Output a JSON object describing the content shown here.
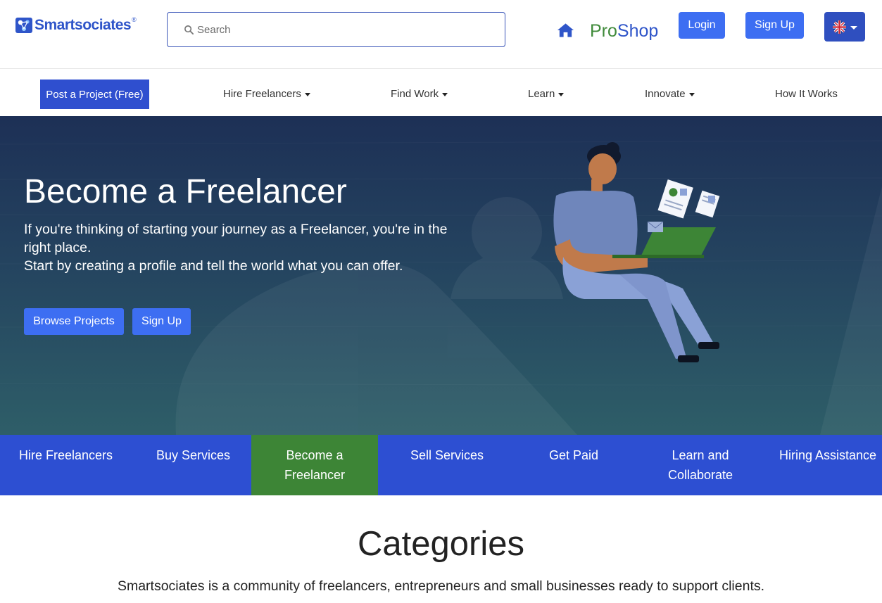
{
  "header": {
    "logo_text": "Smartsociates",
    "logo_reg": "®",
    "search_placeholder": "Search",
    "proshop_pro": "Pro",
    "proshop_shop": "Shop",
    "login_label": "Login",
    "signup_label": "Sign Up",
    "language": "English (UK flag)"
  },
  "nav": {
    "post_project": "Post a Project (Free)",
    "items": [
      {
        "label": "Hire Freelancers",
        "dropdown": true
      },
      {
        "label": "Find Work",
        "dropdown": true
      },
      {
        "label": "Learn",
        "dropdown": true
      },
      {
        "label": "Innovate",
        "dropdown": true
      },
      {
        "label": "How It Works",
        "dropdown": false
      }
    ]
  },
  "hero": {
    "title": "Become a Freelancer",
    "line1": "If you're thinking of starting your journey as a Freelancer, you're in the right place.",
    "line2": "Start by creating a profile and tell the world what you can offer.",
    "browse_label": "Browse Projects",
    "signup_label": "Sign Up"
  },
  "tabs": [
    {
      "label": "Hire Freelancers",
      "active": false
    },
    {
      "label": "Buy Services",
      "active": false
    },
    {
      "label": "Become a Freelancer",
      "active": true
    },
    {
      "label": "Sell Services",
      "active": false
    },
    {
      "label": "Get Paid",
      "active": false
    },
    {
      "label": "Learn and Collaborate",
      "active": false
    },
    {
      "label": "Hiring Assistance",
      "active": false
    }
  ],
  "categories": {
    "title": "Categories",
    "description": "Smartsociates is a community of freelancers, entrepreneurs and small businesses ready to support clients."
  },
  "colors": {
    "brand_blue": "#2f55c9",
    "button_blue": "#3d6ef2",
    "tab_blue": "#2d4fd2",
    "active_green": "#3d8536",
    "proshop_green": "#3f8a3a"
  }
}
